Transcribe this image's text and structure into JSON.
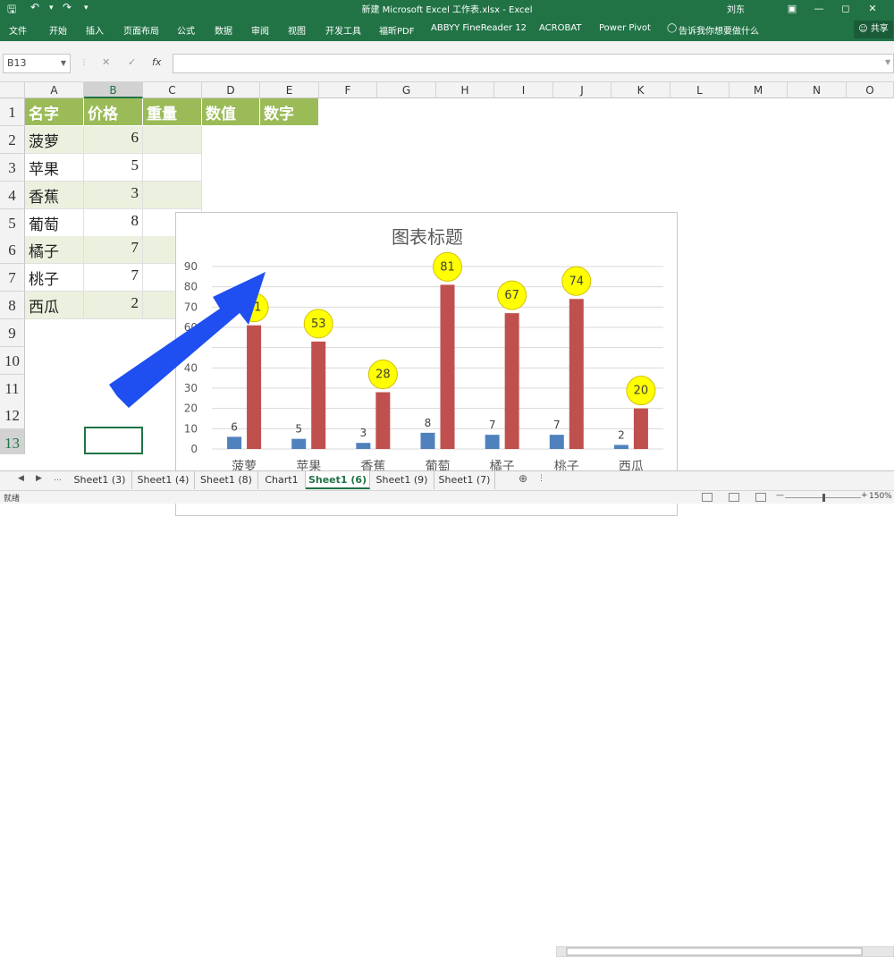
{
  "window": {
    "title": "新建 Microsoft Excel 工作表.xlsx - Excel",
    "user": "刘东"
  },
  "ribbon": {
    "tabs": [
      "文件",
      "开始",
      "插入",
      "页面布局",
      "公式",
      "数据",
      "审阅",
      "视图",
      "开发工具",
      "福昕PDF",
      "ABBYY FineReader 12",
      "ACROBAT",
      "Power Pivot",
      "告诉我你想要做什么"
    ],
    "share": "共享"
  },
  "formula_bar": {
    "name_box": "B13",
    "fx": "fx",
    "formula": ""
  },
  "columns": [
    "A",
    "B",
    "C",
    "D",
    "E",
    "F",
    "G",
    "H",
    "I",
    "J",
    "K",
    "L",
    "M",
    "N",
    "O"
  ],
  "rows": [
    "1",
    "2",
    "3",
    "4",
    "5",
    "6",
    "7",
    "8",
    "9",
    "10",
    "11",
    "12",
    "13"
  ],
  "header_row": [
    "名字",
    "价格",
    "重量",
    "数值",
    "数字"
  ],
  "data_rows": [
    [
      "菠萝",
      "6"
    ],
    [
      "苹果",
      "5"
    ],
    [
      "香蕉",
      "3"
    ],
    [
      "葡萄",
      "8"
    ],
    [
      "橘子",
      "7"
    ],
    [
      "桃子",
      "7"
    ],
    [
      "西瓜",
      "2"
    ]
  ],
  "chart_data": {
    "type": "bar",
    "title": "图表标题",
    "categories": [
      "菠萝",
      "苹果",
      "香蕉",
      "葡萄",
      "橘子",
      "桃子",
      "西瓜"
    ],
    "series": [
      {
        "name": "价格",
        "values": [
          6,
          5,
          3,
          8,
          7,
          7,
          2
        ],
        "color": "#4f81bd"
      },
      {
        "name": "重量",
        "values": [
          61,
          53,
          28,
          81,
          67,
          74,
          20
        ],
        "color": "#c0504d"
      }
    ],
    "yticks": [
      "0",
      "10",
      "20",
      "30",
      "40",
      "50",
      "60",
      "70",
      "80",
      "90"
    ],
    "ylim": [
      0,
      90
    ],
    "grid": true,
    "legend": "bottom",
    "callout_color": "#ffff00"
  },
  "sheets": [
    "Sheet1 (3)",
    "Sheet1 (4)",
    "Sheet1 (8)",
    "Chart1",
    "Sheet1 (6)",
    "Sheet1 (9)",
    "Sheet1 (7)"
  ],
  "active_sheet": "Sheet1 (6)",
  "status": {
    "ready": "就绪",
    "zoom": "150%"
  },
  "colors": {
    "excel_green": "#217346",
    "header_fill": "#9bbb59",
    "band_fill": "#ebf1de",
    "arrow": "#1f4ff0"
  }
}
